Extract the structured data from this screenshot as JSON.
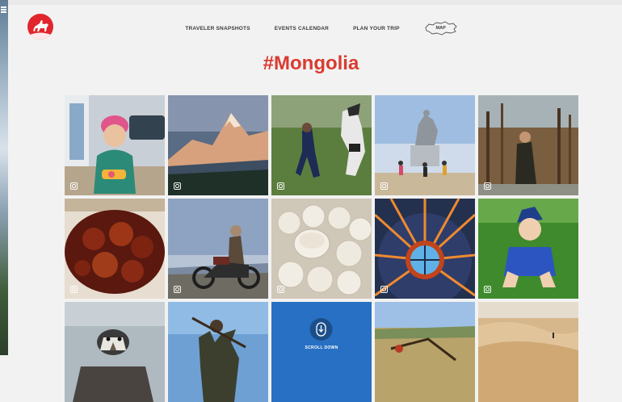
{
  "header": {
    "nav": [
      {
        "label": "TRAVELER SNAPSHOTS"
      },
      {
        "label": "EVENTS CALENDAR"
      },
      {
        "label": "PLAN YOUR TRIP"
      }
    ],
    "map_label": "MAP"
  },
  "page": {
    "title": "#Mongolia"
  },
  "gallery": {
    "scroll_label": "SCROLL DOWN",
    "tiles": [
      {
        "icon": "instagram-icon"
      },
      {
        "icon": "instagram-icon"
      },
      {
        "icon": "instagram-icon"
      },
      {
        "icon": "instagram-icon"
      },
      {
        "icon": "instagram-icon"
      },
      {
        "icon": "instagram-icon"
      },
      {
        "icon": "instagram-icon"
      },
      {
        "icon": "instagram-icon"
      },
      {
        "icon": "instagram-icon"
      },
      {
        "icon": "instagram-icon"
      }
    ]
  },
  "colors": {
    "accent": "#da3b31",
    "logo": "#e0262c",
    "background": "#f2f2f2"
  }
}
